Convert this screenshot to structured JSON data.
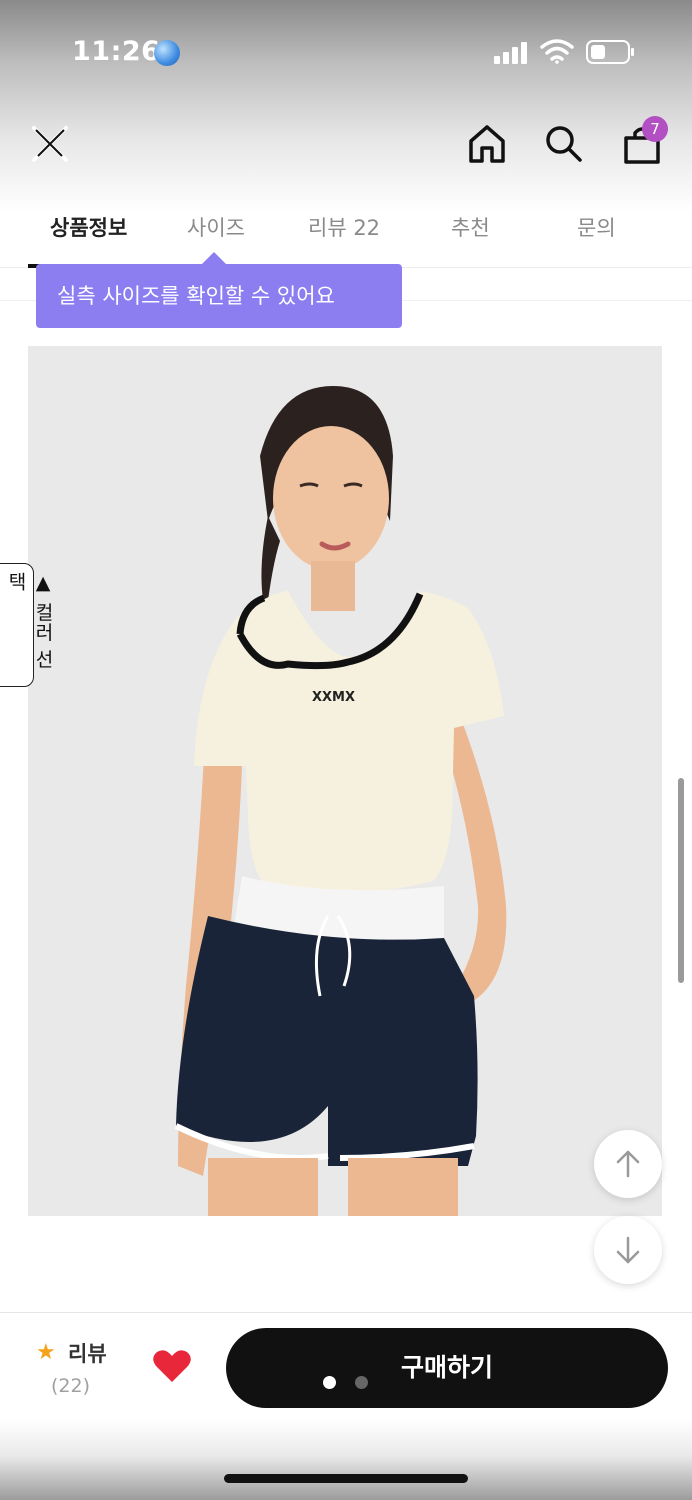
{
  "status_bar": {
    "time": "11:26",
    "icons": [
      "globe-icon",
      "signal-icon",
      "wifi-icon",
      "battery-icon"
    ]
  },
  "header": {
    "icons": [
      "close-icon",
      "home-icon",
      "search-icon",
      "cart-icon"
    ],
    "cart_count": "7",
    "badge_color": "#b24fc2"
  },
  "tabs": [
    {
      "label": "상품정보",
      "active": true
    },
    {
      "label": "사이즈",
      "active": false
    },
    {
      "label": "리뷰 22",
      "active": false
    },
    {
      "label": "추천",
      "active": false
    },
    {
      "label": "문의",
      "active": false
    }
  ],
  "tooltip": {
    "text": "실측 사이즈를 확인할 수 있어요",
    "color": "#8c7df0"
  },
  "product": {
    "shirt_logo": "XXMX"
  },
  "side_tab": {
    "label": "▲ 컬러 선택"
  },
  "floating_buttons": [
    "arrow-up-icon",
    "arrow-down-icon"
  ],
  "bottom_bar": {
    "review_label": "리뷰",
    "review_count": "(22)",
    "buy_label": "구매하기",
    "carousel_index": 1,
    "carousel_total": 2,
    "star_color": "#f4a31b",
    "heart_color": "#e8273b"
  }
}
